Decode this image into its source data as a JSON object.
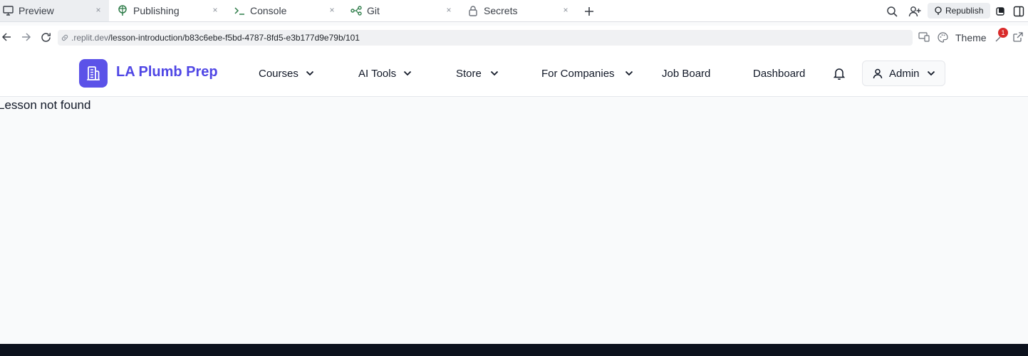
{
  "browser": {
    "tabs": [
      {
        "label": "Preview",
        "icon": "monitor-icon",
        "active": true
      },
      {
        "label": "Publishing",
        "icon": "balloon-icon",
        "active": false
      },
      {
        "label": "Console",
        "icon": "terminal-icon",
        "active": false
      },
      {
        "label": "Git",
        "icon": "git-branch-icon",
        "active": false
      },
      {
        "label": "Secrets",
        "icon": "lock-icon",
        "active": false
      }
    ],
    "close_glyph": "×",
    "republish_label": "Republish",
    "url_domain": ".replit.dev",
    "url_path": "/lesson-introduction/b83c6ebe-f5bd-4787-8fd5-e3b177d9e79b/101",
    "theme_label": "Theme",
    "notification_count": "1"
  },
  "site": {
    "brand": "LA Plumb Prep",
    "nav": {
      "courses": "Courses",
      "ai_tools": "AI Tools",
      "store": "Store",
      "for_companies": "For Companies",
      "job_board": "Job Board",
      "dashboard": "Dashboard"
    },
    "admin_label": "Admin"
  },
  "main": {
    "message": "Lesson not found"
  },
  "colors": {
    "brand": "#4f46e5",
    "logo_bg": "#5b52e8",
    "footer": "#0c111d",
    "badge": "#d92b2b"
  }
}
